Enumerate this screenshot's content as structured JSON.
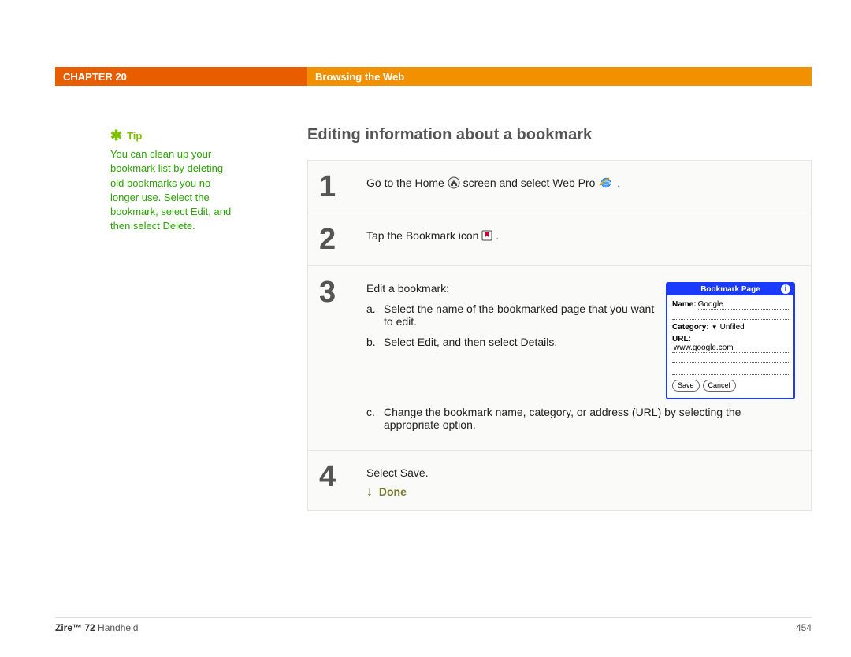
{
  "header": {
    "chapter": "CHAPTER 20",
    "section": "Browsing the Web"
  },
  "title": "Editing information about a bookmark",
  "tip": {
    "label": "Tip",
    "body": "You can clean up your bookmark list by deleting old bookmarks you no longer use. Select the bookmark, select Edit, and then select Delete."
  },
  "steps": {
    "s1": {
      "num": "1",
      "pre": "Go to the Home ",
      "mid": " screen and select Web Pro ",
      "post": "."
    },
    "s2": {
      "num": "2",
      "pre": "Tap the Bookmark icon ",
      "post": "."
    },
    "s3": {
      "num": "3",
      "intro": "Edit a bookmark:",
      "a": "Select the name of the bookmarked page that you want to edit.",
      "b": "Select Edit, and then select Details.",
      "c": "Change the bookmark name, category, or address (URL) by selecting the appropriate option."
    },
    "s4": {
      "num": "4",
      "text": "Select Save."
    }
  },
  "done": "Done",
  "device": {
    "title": "Bookmark Page",
    "name_label": "Name:",
    "name_value": "Google",
    "category_label": "Category:",
    "category_value": "Unfiled",
    "url_label": "URL:",
    "url_value": "www.google.com",
    "save": "Save",
    "cancel": "Cancel"
  },
  "footer": {
    "product_bold": "Zire™ 72",
    "product_rest": " Handheld",
    "page": "454"
  }
}
